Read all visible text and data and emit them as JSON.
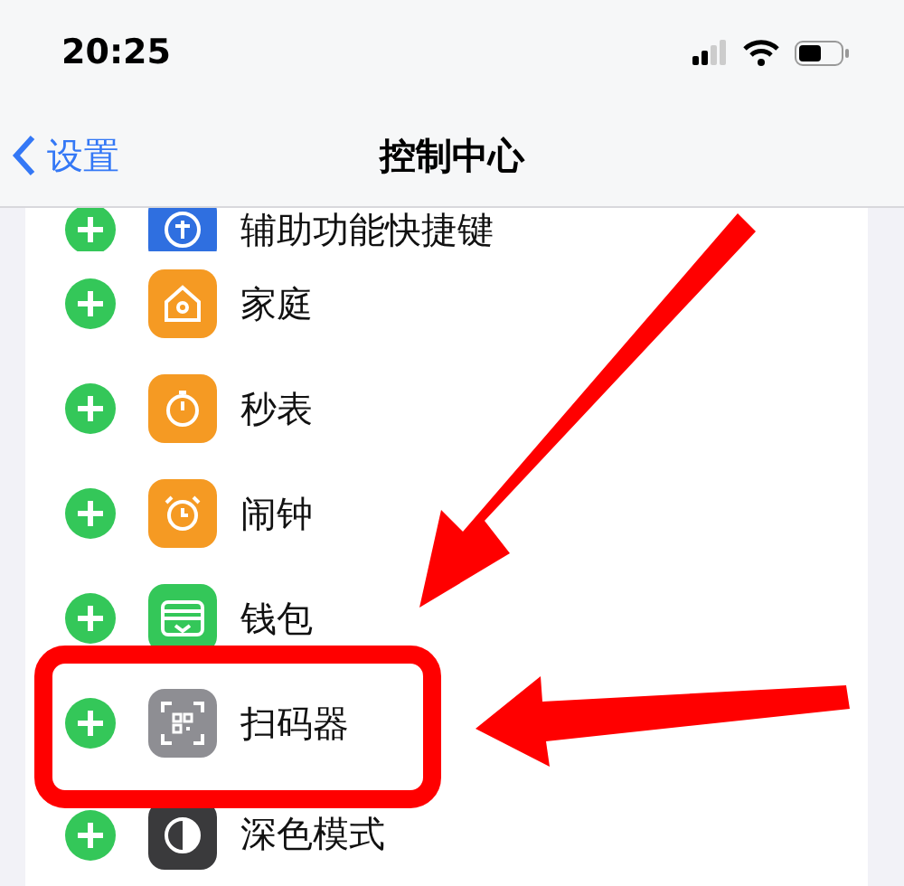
{
  "status_bar": {
    "time": "20:25"
  },
  "nav": {
    "back": "设置",
    "title": "控制中心"
  },
  "rows": [
    {
      "label": "辅助功能快捷键",
      "kind": "accessibility",
      "color": "#2f6fe0",
      "partial": true
    },
    {
      "label": "家庭",
      "kind": "home",
      "color": "#f59a23",
      "partial": false
    },
    {
      "label": "秒表",
      "kind": "stopwatch",
      "color": "#f59a23",
      "partial": false
    },
    {
      "label": "闹钟",
      "kind": "alarm",
      "color": "#f59a23",
      "partial": false
    },
    {
      "label": "钱包",
      "kind": "wallet",
      "color": "#34c759",
      "partial": false
    },
    {
      "label": "扫码器",
      "kind": "scanner",
      "color": "#8e8e93",
      "partial": false
    },
    {
      "label": "深色模式",
      "kind": "darkmode",
      "color": "#3a3a3c",
      "partial": false
    }
  ]
}
